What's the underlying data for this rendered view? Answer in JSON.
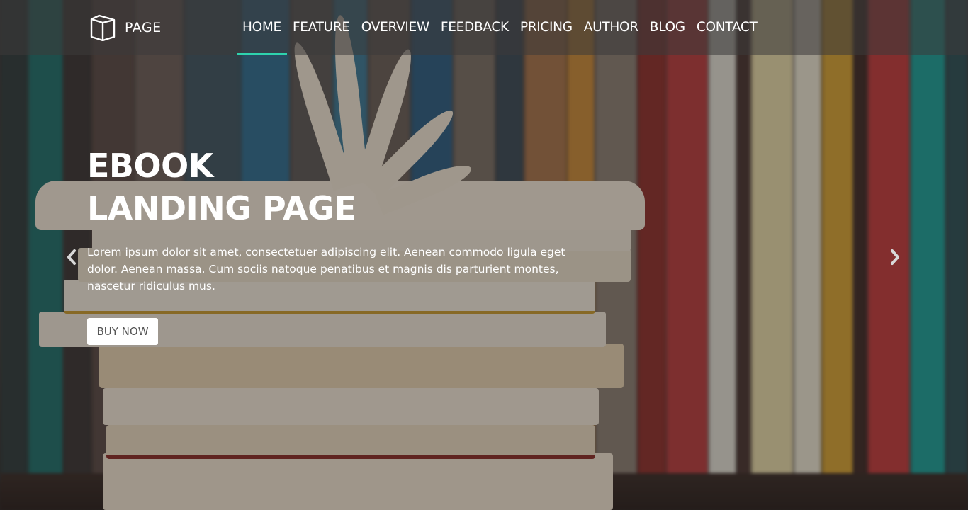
{
  "brand": {
    "icon": "open-book-icon",
    "name": "PAGE"
  },
  "nav": {
    "items": [
      {
        "label": "HOME",
        "active": true
      },
      {
        "label": "FEATURE"
      },
      {
        "label": "OVERVIEW"
      },
      {
        "label": "FEEDBACK"
      },
      {
        "label": "PRICING"
      },
      {
        "label": "AUTHOR"
      },
      {
        "label": "BLOG"
      },
      {
        "label": "CONTACT"
      }
    ],
    "active_color": "#2ed3ae"
  },
  "hero": {
    "title_line1": "EBOOK",
    "title_line2": "LANDING PAGE",
    "description": "Lorem ipsum dolor sit amet, consectetuer adipiscing elit. Aenean commodo ligula eget dolor. Aenean massa. Cum sociis natoque penatibus et magnis dis parturient montes, nascetur ridiculus mus.",
    "button_label": "BUY NOW"
  },
  "carousel": {
    "prev_icon": "chevron-left-icon",
    "next_icon": "chevron-right-icon"
  }
}
